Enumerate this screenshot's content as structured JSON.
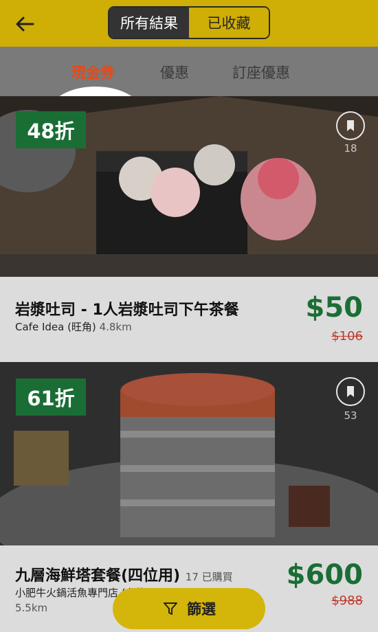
{
  "header": {
    "segments": [
      "所有結果",
      "已收藏"
    ]
  },
  "tabs": [
    "現金券",
    "優惠",
    "訂座優惠"
  ],
  "deals": [
    {
      "discount": "48折",
      "bookmarks": "18",
      "title": "岩漿吐司 - 1人岩漿吐司下午茶餐",
      "shop": "Cafe Idea (旺角)",
      "distance": "4.8km",
      "price": "$50",
      "orig_price": "$106"
    },
    {
      "discount": "61折",
      "bookmarks": "53",
      "title": "九層海鮮塔套餐(四位用)",
      "sold": "17 已購買",
      "shop": "小肥牛火鍋活魚專門店 (九龍)",
      "distance": "5.5km",
      "price": "$600",
      "orig_price": "$988"
    }
  ],
  "filter": {
    "label": "篩選"
  },
  "icons": [
    "back-arrow-icon",
    "bookmark-icon",
    "filter-funnel-icon"
  ]
}
